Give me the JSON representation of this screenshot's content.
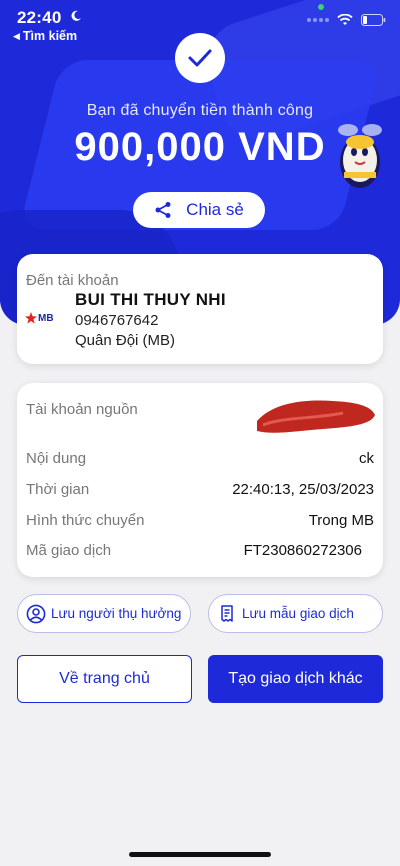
{
  "status_bar": {
    "time": "22:40",
    "back_label": "Tìm kiếm"
  },
  "header": {
    "message": "Bạn đã chuyển tiền thành công",
    "amount": "900,000 VND",
    "share_label": "Chia sẻ"
  },
  "destination": {
    "label": "Đến tài khoản",
    "bank_logo_text": "MB",
    "name": "BUI THI THUY NHI",
    "account_number": "0946767642",
    "bank": "Quân Đội (MB)"
  },
  "details": {
    "source_label": "Tài khoản nguồn",
    "rows": [
      {
        "key": "Nội dung",
        "value": "ck"
      },
      {
        "key": "Thời gian",
        "value": "22:40:13, 25/03/2023"
      },
      {
        "key": "Hình thức chuyển",
        "value": "Trong MB"
      },
      {
        "key": "Mã giao dịch",
        "value": "FT230860272306"
      }
    ]
  },
  "actions": {
    "save_beneficiary": "Lưu người thụ hưởng",
    "save_template": "Lưu mẫu giao dịch",
    "home": "Về trang chủ",
    "new_transaction": "Tạo giao dịch khác"
  },
  "colors": {
    "primary": "#1e2ad9",
    "background": "#f1f1f4",
    "success_check": "#1e2ad9"
  },
  "icons": [
    "moon-icon",
    "wifi-icon",
    "battery-icon",
    "check-icon",
    "share-icon",
    "user-icon",
    "receipt-icon",
    "mascot-icon"
  ]
}
